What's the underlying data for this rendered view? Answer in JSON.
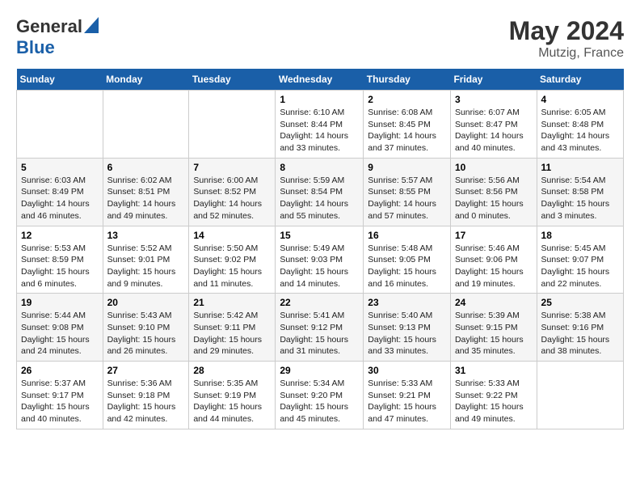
{
  "logo": {
    "general": "General",
    "blue": "Blue"
  },
  "title": {
    "month": "May 2024",
    "location": "Mutzig, France"
  },
  "headers": [
    "Sunday",
    "Monday",
    "Tuesday",
    "Wednesday",
    "Thursday",
    "Friday",
    "Saturday"
  ],
  "weeks": [
    [
      {
        "day": "",
        "sunrise": "",
        "sunset": "",
        "daylight": ""
      },
      {
        "day": "",
        "sunrise": "",
        "sunset": "",
        "daylight": ""
      },
      {
        "day": "",
        "sunrise": "",
        "sunset": "",
        "daylight": ""
      },
      {
        "day": "1",
        "sunrise": "Sunrise: 6:10 AM",
        "sunset": "Sunset: 8:44 PM",
        "daylight": "Daylight: 14 hours and 33 minutes."
      },
      {
        "day": "2",
        "sunrise": "Sunrise: 6:08 AM",
        "sunset": "Sunset: 8:45 PM",
        "daylight": "Daylight: 14 hours and 37 minutes."
      },
      {
        "day": "3",
        "sunrise": "Sunrise: 6:07 AM",
        "sunset": "Sunset: 8:47 PM",
        "daylight": "Daylight: 14 hours and 40 minutes."
      },
      {
        "day": "4",
        "sunrise": "Sunrise: 6:05 AM",
        "sunset": "Sunset: 8:48 PM",
        "daylight": "Daylight: 14 hours and 43 minutes."
      }
    ],
    [
      {
        "day": "5",
        "sunrise": "Sunrise: 6:03 AM",
        "sunset": "Sunset: 8:49 PM",
        "daylight": "Daylight: 14 hours and 46 minutes."
      },
      {
        "day": "6",
        "sunrise": "Sunrise: 6:02 AM",
        "sunset": "Sunset: 8:51 PM",
        "daylight": "Daylight: 14 hours and 49 minutes."
      },
      {
        "day": "7",
        "sunrise": "Sunrise: 6:00 AM",
        "sunset": "Sunset: 8:52 PM",
        "daylight": "Daylight: 14 hours and 52 minutes."
      },
      {
        "day": "8",
        "sunrise": "Sunrise: 5:59 AM",
        "sunset": "Sunset: 8:54 PM",
        "daylight": "Daylight: 14 hours and 55 minutes."
      },
      {
        "day": "9",
        "sunrise": "Sunrise: 5:57 AM",
        "sunset": "Sunset: 8:55 PM",
        "daylight": "Daylight: 14 hours and 57 minutes."
      },
      {
        "day": "10",
        "sunrise": "Sunrise: 5:56 AM",
        "sunset": "Sunset: 8:56 PM",
        "daylight": "Daylight: 15 hours and 0 minutes."
      },
      {
        "day": "11",
        "sunrise": "Sunrise: 5:54 AM",
        "sunset": "Sunset: 8:58 PM",
        "daylight": "Daylight: 15 hours and 3 minutes."
      }
    ],
    [
      {
        "day": "12",
        "sunrise": "Sunrise: 5:53 AM",
        "sunset": "Sunset: 8:59 PM",
        "daylight": "Daylight: 15 hours and 6 minutes."
      },
      {
        "day": "13",
        "sunrise": "Sunrise: 5:52 AM",
        "sunset": "Sunset: 9:01 PM",
        "daylight": "Daylight: 15 hours and 9 minutes."
      },
      {
        "day": "14",
        "sunrise": "Sunrise: 5:50 AM",
        "sunset": "Sunset: 9:02 PM",
        "daylight": "Daylight: 15 hours and 11 minutes."
      },
      {
        "day": "15",
        "sunrise": "Sunrise: 5:49 AM",
        "sunset": "Sunset: 9:03 PM",
        "daylight": "Daylight: 15 hours and 14 minutes."
      },
      {
        "day": "16",
        "sunrise": "Sunrise: 5:48 AM",
        "sunset": "Sunset: 9:05 PM",
        "daylight": "Daylight: 15 hours and 16 minutes."
      },
      {
        "day": "17",
        "sunrise": "Sunrise: 5:46 AM",
        "sunset": "Sunset: 9:06 PM",
        "daylight": "Daylight: 15 hours and 19 minutes."
      },
      {
        "day": "18",
        "sunrise": "Sunrise: 5:45 AM",
        "sunset": "Sunset: 9:07 PM",
        "daylight": "Daylight: 15 hours and 22 minutes."
      }
    ],
    [
      {
        "day": "19",
        "sunrise": "Sunrise: 5:44 AM",
        "sunset": "Sunset: 9:08 PM",
        "daylight": "Daylight: 15 hours and 24 minutes."
      },
      {
        "day": "20",
        "sunrise": "Sunrise: 5:43 AM",
        "sunset": "Sunset: 9:10 PM",
        "daylight": "Daylight: 15 hours and 26 minutes."
      },
      {
        "day": "21",
        "sunrise": "Sunrise: 5:42 AM",
        "sunset": "Sunset: 9:11 PM",
        "daylight": "Daylight: 15 hours and 29 minutes."
      },
      {
        "day": "22",
        "sunrise": "Sunrise: 5:41 AM",
        "sunset": "Sunset: 9:12 PM",
        "daylight": "Daylight: 15 hours and 31 minutes."
      },
      {
        "day": "23",
        "sunrise": "Sunrise: 5:40 AM",
        "sunset": "Sunset: 9:13 PM",
        "daylight": "Daylight: 15 hours and 33 minutes."
      },
      {
        "day": "24",
        "sunrise": "Sunrise: 5:39 AM",
        "sunset": "Sunset: 9:15 PM",
        "daylight": "Daylight: 15 hours and 35 minutes."
      },
      {
        "day": "25",
        "sunrise": "Sunrise: 5:38 AM",
        "sunset": "Sunset: 9:16 PM",
        "daylight": "Daylight: 15 hours and 38 minutes."
      }
    ],
    [
      {
        "day": "26",
        "sunrise": "Sunrise: 5:37 AM",
        "sunset": "Sunset: 9:17 PM",
        "daylight": "Daylight: 15 hours and 40 minutes."
      },
      {
        "day": "27",
        "sunrise": "Sunrise: 5:36 AM",
        "sunset": "Sunset: 9:18 PM",
        "daylight": "Daylight: 15 hours and 42 minutes."
      },
      {
        "day": "28",
        "sunrise": "Sunrise: 5:35 AM",
        "sunset": "Sunset: 9:19 PM",
        "daylight": "Daylight: 15 hours and 44 minutes."
      },
      {
        "day": "29",
        "sunrise": "Sunrise: 5:34 AM",
        "sunset": "Sunset: 9:20 PM",
        "daylight": "Daylight: 15 hours and 45 minutes."
      },
      {
        "day": "30",
        "sunrise": "Sunrise: 5:33 AM",
        "sunset": "Sunset: 9:21 PM",
        "daylight": "Daylight: 15 hours and 47 minutes."
      },
      {
        "day": "31",
        "sunrise": "Sunrise: 5:33 AM",
        "sunset": "Sunset: 9:22 PM",
        "daylight": "Daylight: 15 hours and 49 minutes."
      },
      {
        "day": "",
        "sunrise": "",
        "sunset": "",
        "daylight": ""
      }
    ]
  ]
}
